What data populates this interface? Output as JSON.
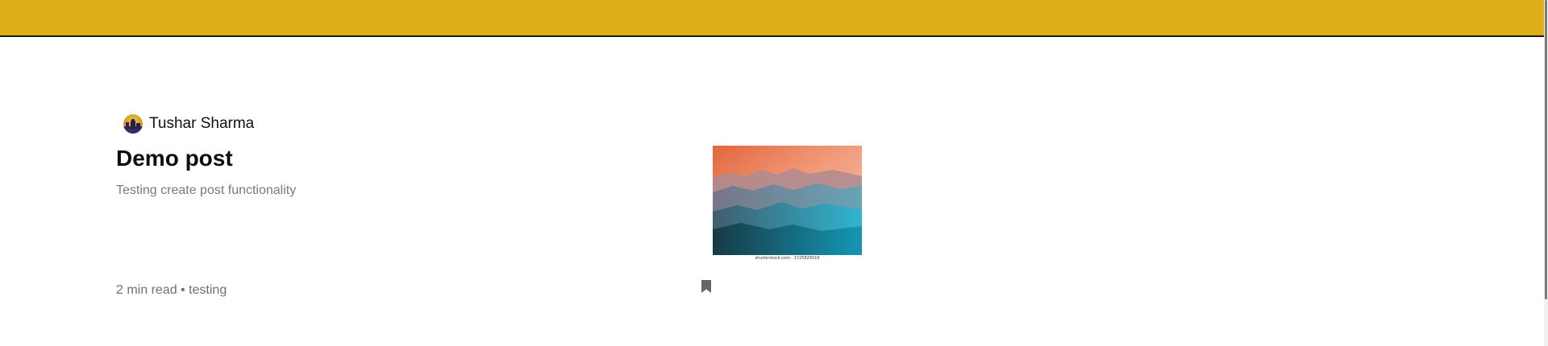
{
  "colors": {
    "topbar": "#dfae17",
    "title": "#0d0d0d",
    "subtitle": "#7a7a7a",
    "meta": "#6f6f6f"
  },
  "post": {
    "author": "Tushar Sharma",
    "title": "Demo post",
    "subtitle": "Testing create post functionality",
    "meta": "2 min read • testing",
    "image_watermark": "shutterstock.com · 1725825019"
  },
  "icons": {
    "avatar": "author-avatar",
    "bookmark": "bookmark-icon"
  }
}
